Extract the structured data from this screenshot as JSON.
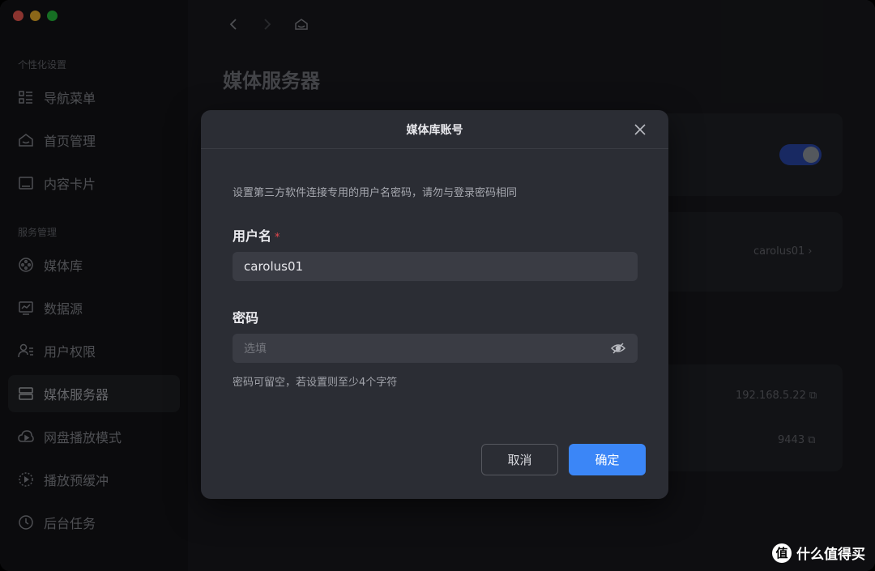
{
  "sidebar": {
    "section1_title": "个性化设置",
    "section2_title": "服务管理",
    "items": [
      {
        "label": "导航菜单",
        "icon": "list-icon"
      },
      {
        "label": "首页管理",
        "icon": "home-icon"
      },
      {
        "label": "内容卡片",
        "icon": "card-icon"
      },
      {
        "label": "媒体库",
        "icon": "media-library-icon"
      },
      {
        "label": "数据源",
        "icon": "monitor-chart-icon"
      },
      {
        "label": "用户权限",
        "icon": "user-permission-icon"
      },
      {
        "label": "媒体服务器",
        "icon": "server-icon",
        "active": true
      },
      {
        "label": "网盘播放模式",
        "icon": "cloud-play-icon"
      },
      {
        "label": "播放预缓冲",
        "icon": "buffer-icon"
      },
      {
        "label": "后台任务",
        "icon": "clock-icon"
      }
    ]
  },
  "main": {
    "page_title": "媒体服务器",
    "account_value": "carolus01",
    "ip_value": "192.168.5.22",
    "port_value": "9443",
    "accent_color": "#3b86f7"
  },
  "dialog": {
    "title": "媒体库账号",
    "description": "设置第三方软件连接专用的用户名密码，请勿与登录密码相同",
    "username_label": "用户名",
    "required_mark": "*",
    "username_value": "carolus01",
    "password_label": "密码",
    "password_placeholder": "选填",
    "password_hint": "密码可留空，若设置则至少4个字符",
    "cancel_label": "取消",
    "confirm_label": "确定"
  },
  "watermark": {
    "logo_text": "值",
    "text": "什么值得买"
  }
}
